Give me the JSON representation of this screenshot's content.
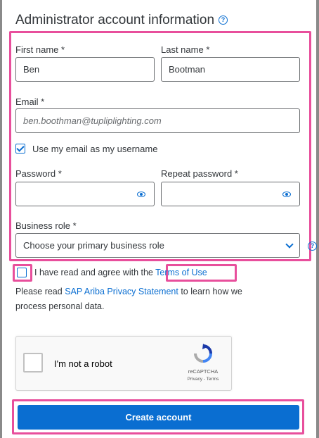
{
  "header": {
    "title": "Administrator account information",
    "help_icon": "help-circle-icon"
  },
  "form": {
    "first_name": {
      "label": "First name *",
      "value": "Ben"
    },
    "last_name": {
      "label": "Last name *",
      "value": "Bootman"
    },
    "email": {
      "label": "Email *",
      "placeholder": "ben.boothman@tupliplighting.com"
    },
    "use_email_username": {
      "label": "Use my email as my username",
      "checked": true
    },
    "password": {
      "label": "Password *",
      "value": "",
      "icon": "eye-icon"
    },
    "repeat_password": {
      "label": "Repeat password *",
      "value": "",
      "icon": "eye-icon"
    },
    "business_role": {
      "label": "Business role *",
      "selected": "Choose your primary business role",
      "icon": "chevron-down-icon"
    }
  },
  "terms": {
    "prefix": "I have read and agree with the",
    "link": "Terms of Use",
    "checked": false
  },
  "privacy": {
    "line1_prefix": "Please read ",
    "line1_link": "SAP Ariba Privacy Statement",
    "line1_suffix": " to learn how we",
    "line2": "process personal data."
  },
  "captcha": {
    "label": "I'm not a robot",
    "brand": "reCAPTCHA",
    "terms": "Privacy - Terms"
  },
  "actions": {
    "create_account": "Create account"
  },
  "colors": {
    "accent": "#0a6ed1",
    "highlight": "#e84f9c",
    "text": "#32363a"
  }
}
